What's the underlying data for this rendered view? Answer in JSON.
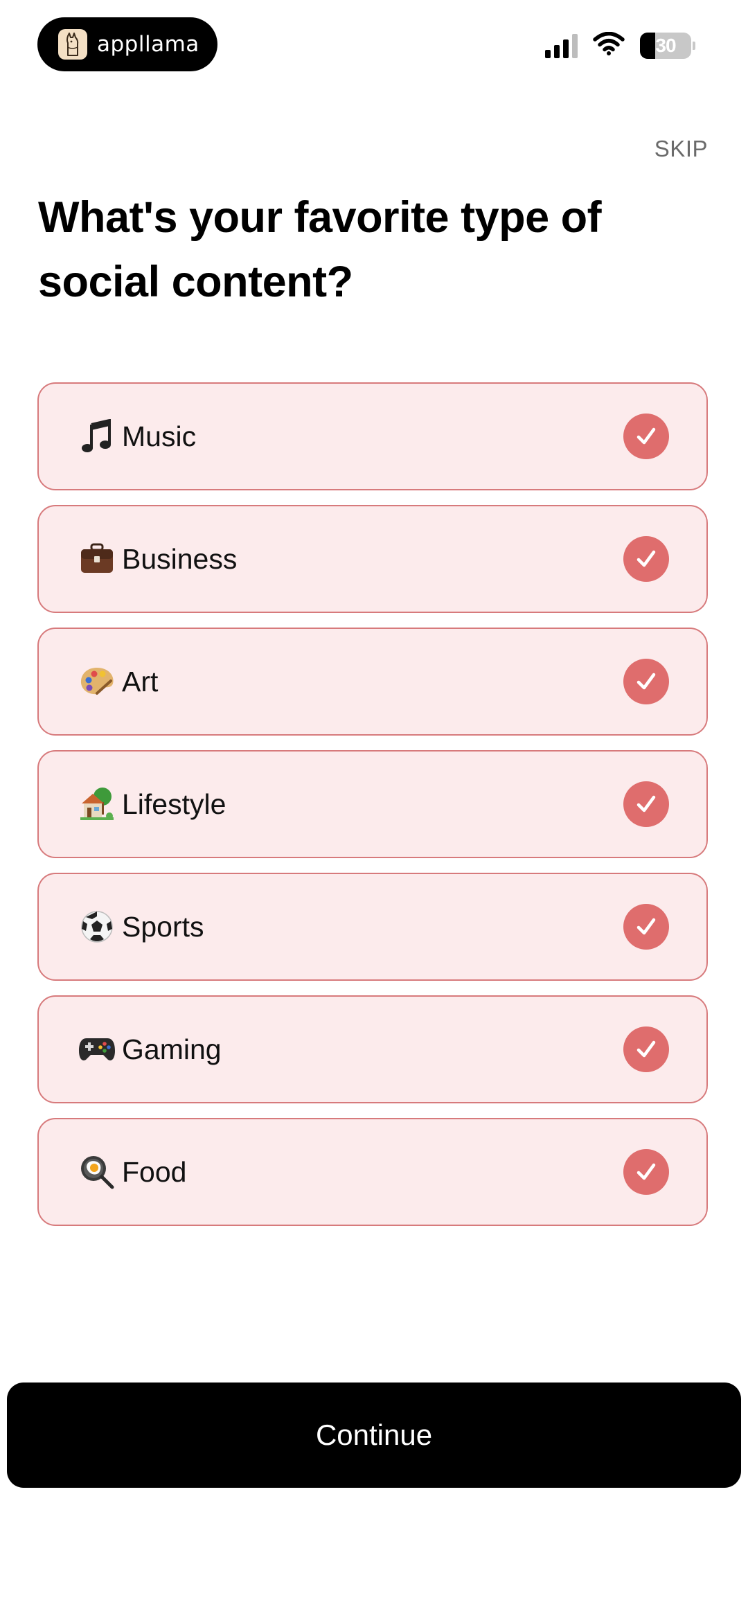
{
  "status_bar": {
    "brand_name": "appllama",
    "battery_level": "30",
    "battery_fraction": 0.3
  },
  "skip_label": "SKIP",
  "title": "What's your favorite type of social content?",
  "options": [
    {
      "label": "Music",
      "icon": "musical-note-icon",
      "selected": true
    },
    {
      "label": "Business",
      "icon": "briefcase-icon",
      "selected": true
    },
    {
      "label": "Art",
      "icon": "artist-palette-icon",
      "selected": true
    },
    {
      "label": "Lifestyle",
      "icon": "house-with-garden-icon",
      "selected": true
    },
    {
      "label": "Sports",
      "icon": "soccer-ball-icon",
      "selected": true
    },
    {
      "label": "Gaming",
      "icon": "game-controller-icon",
      "selected": true
    },
    {
      "label": "Food",
      "icon": "frying-pan-egg-icon",
      "selected": true
    }
  ],
  "continue_label": "Continue",
  "colors": {
    "option_bg": "#fcebec",
    "option_border": "#d77a7c",
    "check_bg": "#df6d6d",
    "button_bg": "#000000"
  }
}
